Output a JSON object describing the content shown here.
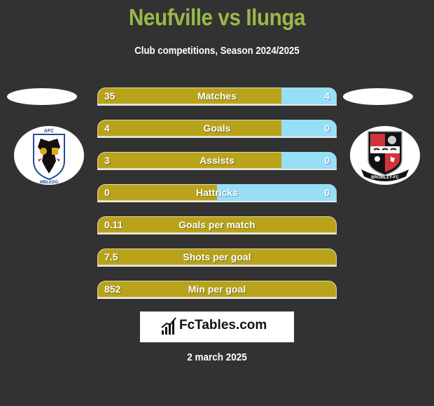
{
  "header": {
    "title": "Neufville vs Ilunga",
    "subtitle": "Club competitions, Season 2024/2025"
  },
  "teams": {
    "left": {
      "logo_icon": "afc-wimbledon-crest-icon",
      "logo_text_top": "AFC",
      "logo_text_bottom": "WIMBLEDON"
    },
    "right": {
      "logo_icon": "bromley-fc-crest-icon",
      "logo_text_bottom": "BROMLEY-FC"
    }
  },
  "colors": {
    "left_bar": "#b8a31a",
    "right_bar": "#97def7",
    "title": "#9ab84a",
    "background": "#323232"
  },
  "stats": [
    {
      "label": "Matches",
      "left": "35",
      "right": "4",
      "right_share": 0.23
    },
    {
      "label": "Goals",
      "left": "4",
      "right": "0",
      "right_share": 0.23
    },
    {
      "label": "Assists",
      "left": "3",
      "right": "0",
      "right_share": 0.23
    },
    {
      "label": "Hattricks",
      "left": "0",
      "right": "0",
      "right_share": 0.5
    },
    {
      "label": "Goals per match",
      "left": "0.11",
      "right": null,
      "right_share": 0
    },
    {
      "label": "Shots per goal",
      "left": "7.5",
      "right": null,
      "right_share": 0
    },
    {
      "label": "Min per goal",
      "left": "852",
      "right": null,
      "right_share": 0
    }
  ],
  "brand": {
    "name": "FcTables.com",
    "icon": "bar-chart-icon"
  },
  "date": "2 march 2025"
}
